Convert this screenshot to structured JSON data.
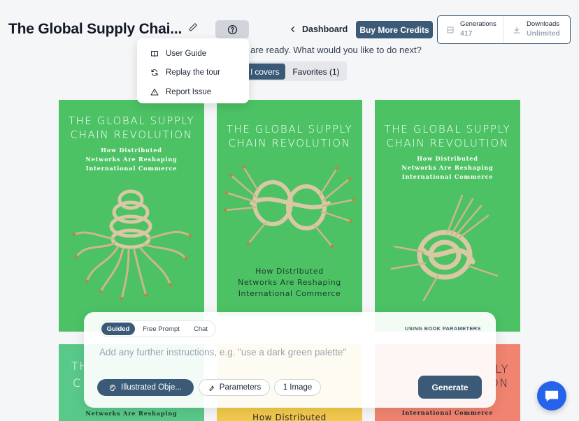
{
  "header": {
    "title": "The Global Supply Chai...",
    "dashboard_label": "Dashboard",
    "buy_credits_label": "Buy More Credits",
    "stats": [
      {
        "label": "Generations",
        "value": "417"
      },
      {
        "label": "Downloads",
        "value": "Unlimited"
      }
    ]
  },
  "help_menu": {
    "items": [
      {
        "label": "User Guide",
        "icon": "book-icon"
      },
      {
        "label": "Replay the tour",
        "icon": "refresh-icon"
      },
      {
        "label": "Report Issue",
        "icon": "warning-icon"
      }
    ]
  },
  "intro_text": "s are ready. What would you like to do next?",
  "view_tabs": {
    "active": "l covers",
    "favorites": "Favorites (1)"
  },
  "covers": [
    {
      "title_lines": [
        "THE GLOBAL SUPPLY",
        "CHAIN REVOLUTION"
      ],
      "subtitle_lines": [
        "How Distributed",
        "Networks Are Reshaping",
        "International Commerce"
      ],
      "background": "#4cc265"
    },
    {
      "title_lines": [
        "THE GLOBAL SUPPLY",
        "CHAIN REVOLUTION"
      ],
      "subtitle_lines": [
        "How Distributed",
        "Networks Are Reshaping",
        "International Commerce"
      ],
      "background": "#4cc265"
    },
    {
      "title_lines": [
        "THE GLOBAL SUPPLY",
        "CHAIN REVOLUTION"
      ],
      "subtitle_lines": [
        "How Distributed",
        "Networks Are Reshaping",
        "International Commerce"
      ],
      "background": "#4cc265"
    }
  ],
  "bottom_covers": [
    {
      "fragment_title": "TH",
      "fragment_title2": "C",
      "fragment_sub": "Networks Are Reshaping",
      "background": "#59c98a"
    },
    {
      "fragment_sub": "How Distributed",
      "background": "#f2c94c"
    },
    {
      "fragment_title": "LY",
      "fragment_title2": "ON",
      "fragment_sub": "International Commerce",
      "background": "#f08470"
    }
  ],
  "prompt_panel": {
    "modes": [
      "Guided",
      "Free Prompt",
      "Chat"
    ],
    "active_mode": "Guided",
    "using_label": "USING BOOK PARAMETERS",
    "placeholder": "Add any further instructions, e.g. \"use a dark green palette\"",
    "style_pill": "Illustrated Obje...",
    "parameters_pill": "Parameters",
    "images_pill": "1 Image",
    "generate_label": "Generate"
  },
  "colors": {
    "accent": "#3b5a78",
    "cover_green": "#4cc265",
    "chat_fab": "#2563eb"
  }
}
